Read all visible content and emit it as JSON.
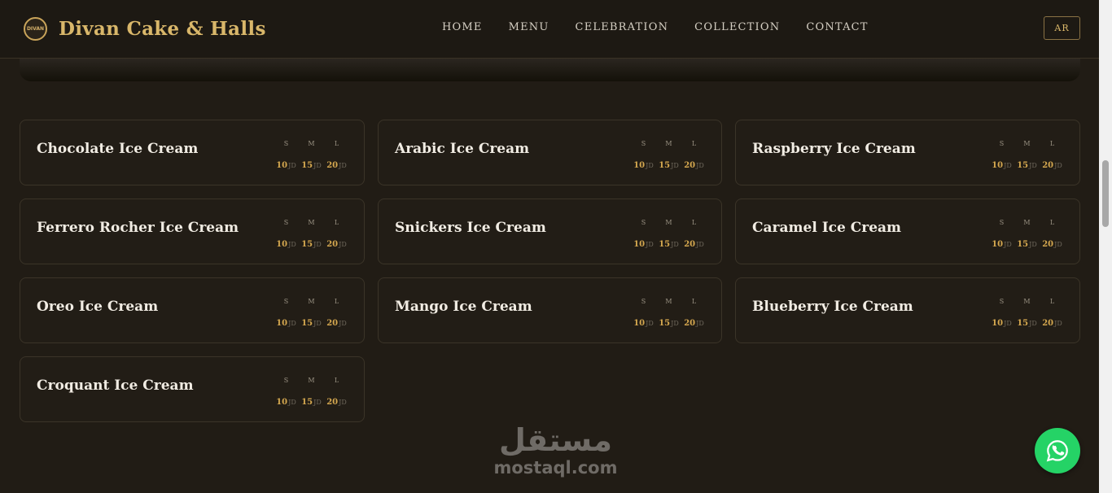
{
  "header": {
    "logo_text": "DIVAN",
    "brand_name": "Divan Cake & Halls",
    "nav": [
      {
        "id": "home",
        "label": "HOME"
      },
      {
        "id": "menu",
        "label": "MENU"
      },
      {
        "id": "celebration",
        "label": "CELEBRATION"
      },
      {
        "id": "collection",
        "label": "COLLECTION"
      },
      {
        "id": "contact",
        "label": "CONTACT"
      }
    ],
    "lang_button": "AR"
  },
  "size_labels": {
    "s": "S",
    "m": "M",
    "l": "L"
  },
  "currency": "JD",
  "items": [
    {
      "name": "Chocolate Ice Cream",
      "prices": [
        "10",
        "15",
        "20"
      ]
    },
    {
      "name": "Arabic Ice Cream",
      "prices": [
        "10",
        "15",
        "20"
      ]
    },
    {
      "name": "Raspberry Ice Cream",
      "prices": [
        "10",
        "15",
        "20"
      ]
    },
    {
      "name": "Ferrero Rocher Ice Cream",
      "prices": [
        "10",
        "15",
        "20"
      ]
    },
    {
      "name": "Snickers Ice Cream",
      "prices": [
        "10",
        "15",
        "20"
      ]
    },
    {
      "name": "Caramel Ice Cream",
      "prices": [
        "10",
        "15",
        "20"
      ]
    },
    {
      "name": "Oreo Ice Cream",
      "prices": [
        "10",
        "15",
        "20"
      ]
    },
    {
      "name": "Mango Ice Cream",
      "prices": [
        "10",
        "15",
        "20"
      ]
    },
    {
      "name": "Blueberry Ice Cream",
      "prices": [
        "10",
        "15",
        "20"
      ]
    },
    {
      "name": "Croquant Ice Cream",
      "prices": [
        "10",
        "15",
        "20"
      ]
    }
  ],
  "watermark": {
    "arabic": "مستقل",
    "latin": "mostaql.com"
  },
  "colors": {
    "accent": "#d4a74f",
    "background": "#211c15",
    "whatsapp": "#25d366"
  }
}
